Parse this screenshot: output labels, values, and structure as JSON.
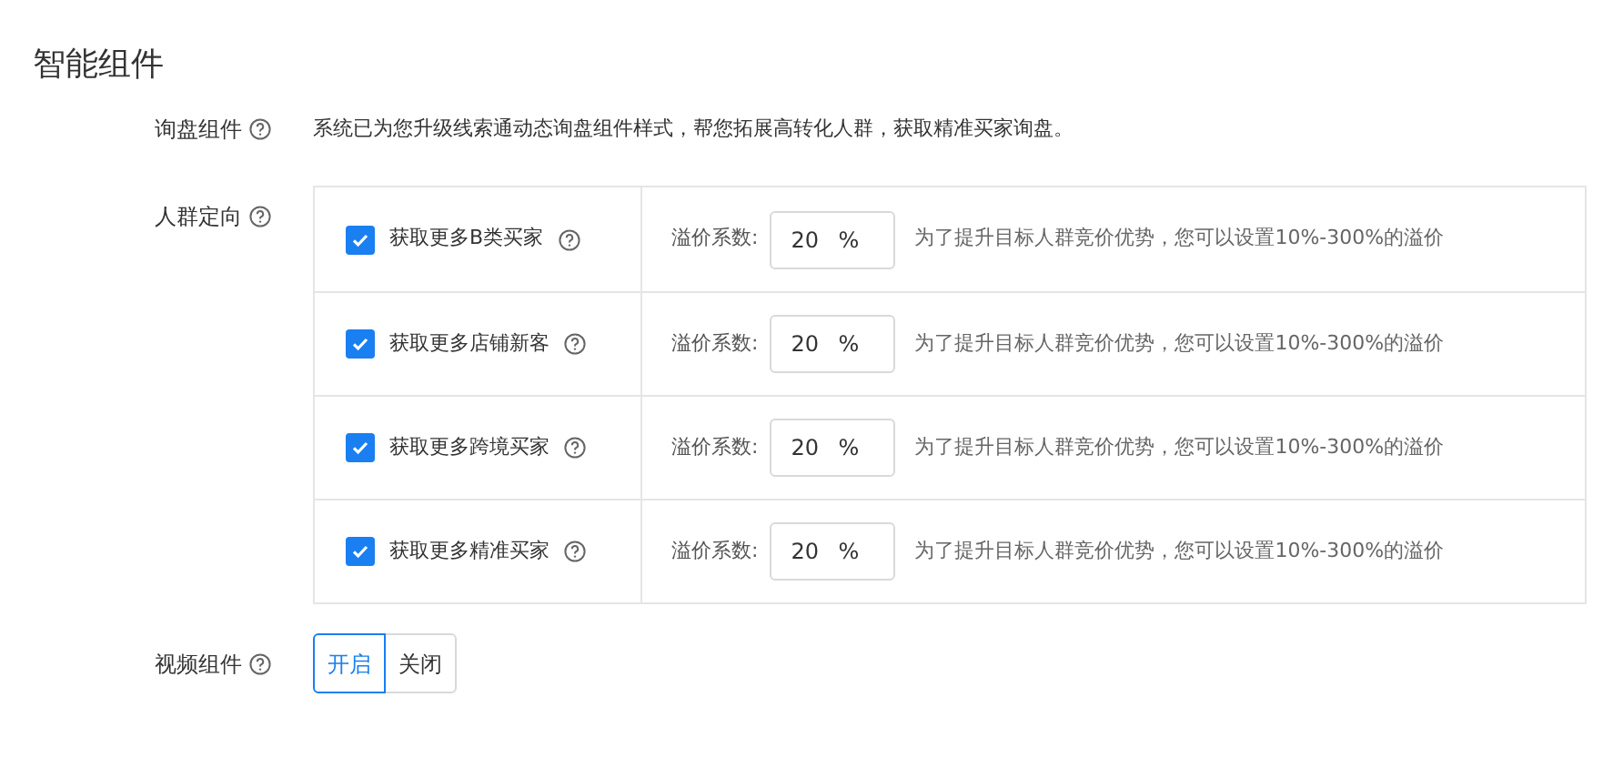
{
  "title": "智能组件",
  "inquiry": {
    "label": "询盘组件",
    "text": "系统已为您升级线索通动态询盘组件样式，帮您拓展高转化人群，获取精准买家询盘。"
  },
  "targeting": {
    "label": "人群定向",
    "rows": [
      {
        "name": "获取更多B类买家",
        "checked": true,
        "coef_label": "溢价系数:",
        "value": "20",
        "unit": "%",
        "hint": "为了提升目标人群竞价优势，您可以设置10%-300%的溢价"
      },
      {
        "name": "获取更多店铺新客",
        "checked": true,
        "coef_label": "溢价系数:",
        "value": "20",
        "unit": "%",
        "hint": "为了提升目标人群竞价优势，您可以设置10%-300%的溢价"
      },
      {
        "name": "获取更多跨境买家",
        "checked": true,
        "coef_label": "溢价系数:",
        "value": "20",
        "unit": "%",
        "hint": "为了提升目标人群竞价优势，您可以设置10%-300%的溢价"
      },
      {
        "name": "获取更多精准买家",
        "checked": true,
        "coef_label": "溢价系数:",
        "value": "20",
        "unit": "%",
        "hint": "为了提升目标人群竞价优势，您可以设置10%-300%的溢价"
      }
    ]
  },
  "video": {
    "label": "视频组件",
    "options": [
      {
        "label": "开启",
        "selected": true
      },
      {
        "label": "关闭",
        "selected": false
      }
    ]
  }
}
